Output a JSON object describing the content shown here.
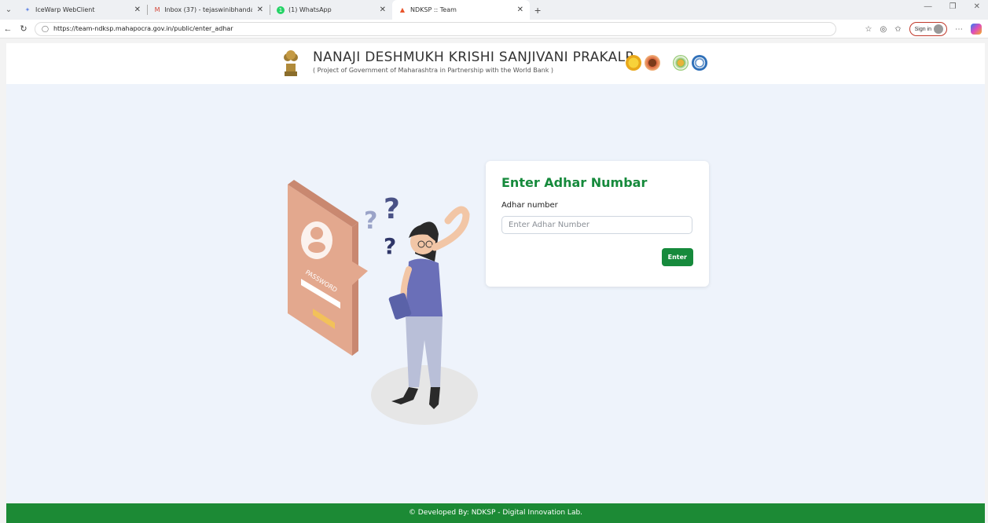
{
  "browser": {
    "tabs": [
      {
        "label": "IceWarp WebClient",
        "icon": "icewarp-icon"
      },
      {
        "label": "Inbox (37) - tejaswinibhandare@g",
        "icon": "gmail-icon"
      },
      {
        "label": "(1) WhatsApp",
        "icon": "whatsapp-icon"
      },
      {
        "label": "NDKSP :: Team",
        "icon": "ndksp-icon"
      }
    ],
    "url": "https://team-ndksp.mahapocra.gov.in/public/enter_adhar",
    "sign_in_label": "Sign in"
  },
  "header": {
    "title": "NANAJI DESHMUKH KRISHI SANJIVANI PRAKALP",
    "subtitle": "( Project of Government of Maharashtra in Partnership with the World Bank )"
  },
  "form": {
    "title": "Enter Adhar Numbar",
    "label": "Adhar number",
    "placeholder": "Enter Adhar Number",
    "button": "Enter"
  },
  "illustration": {
    "card_text": "PASSWORD"
  },
  "footer": {
    "text": "© Developed By: NDKSP - Digital Innovation Lab."
  },
  "colors": {
    "accent": "#168a3c",
    "footer": "#1c8a35",
    "page_bg": "#eef3fb"
  }
}
